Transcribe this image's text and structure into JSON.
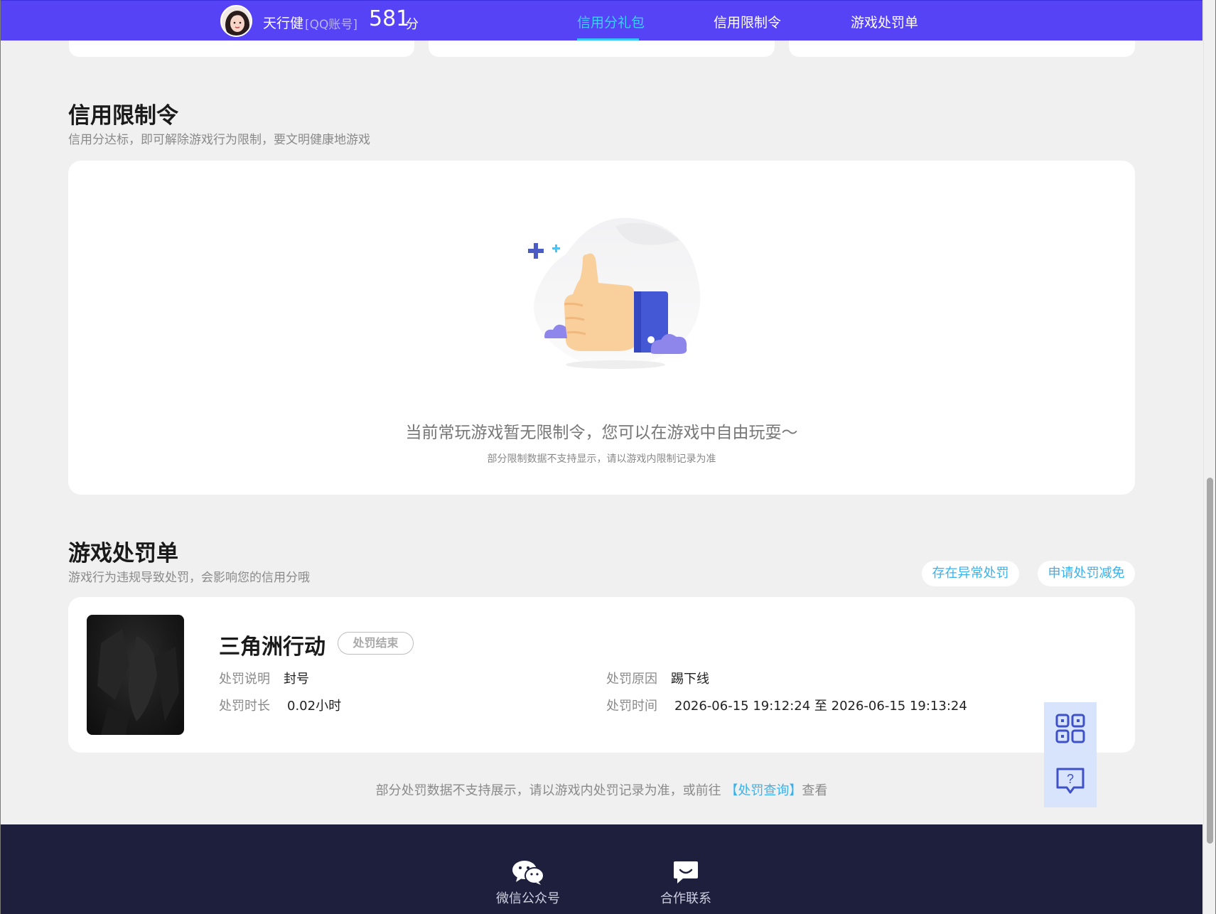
{
  "header": {
    "username": "天行健",
    "account_type": "[QQ账号]",
    "score": "581",
    "score_unit": "分",
    "nav": [
      {
        "label": "信用分礼包",
        "active": true
      },
      {
        "label": "信用限制令",
        "active": false
      },
      {
        "label": "游戏处罚单",
        "active": false
      }
    ]
  },
  "restriction": {
    "title": "信用限制令",
    "subtitle": "信用分达标，即可解除游戏行为限制，要文明健康地游戏",
    "empty_message": "当前常玩游戏暂无限制令，您可以在游戏中自由玩耍～",
    "empty_note": "部分限制数据不支持显示，请以游戏内限制记录为准"
  },
  "penalty": {
    "title": "游戏处罚单",
    "subtitle": "游戏行为违规导致处罚，会影响您的信用分哦",
    "btn_abnormal": "存在异常处罚",
    "btn_appeal": "申请处罚减免",
    "item": {
      "game_name": "三角洲行动",
      "status": "处罚结束",
      "desc_label": "处罚说明",
      "desc_value": "封号",
      "reason_label": "处罚原因",
      "reason_value": "踢下线",
      "duration_label": "处罚时长",
      "duration_value": "0.02小时",
      "time_label": "处罚时间",
      "time_value": "2026-06-15 19:12:24 至 2026-06-15 19:13:24"
    },
    "footnote_prefix": "部分处罚数据不支持展示，请以游戏内处罚记录为准，或前往",
    "footnote_link": "【处罚查询】",
    "footnote_suffix": "查看"
  },
  "footer": {
    "wechat_label": "微信公众号",
    "contact_label": "合作联系"
  },
  "colors": {
    "header_bg": "#5643f5",
    "accent": "#37b2ee",
    "footer_bg": "#1d1f3d"
  }
}
